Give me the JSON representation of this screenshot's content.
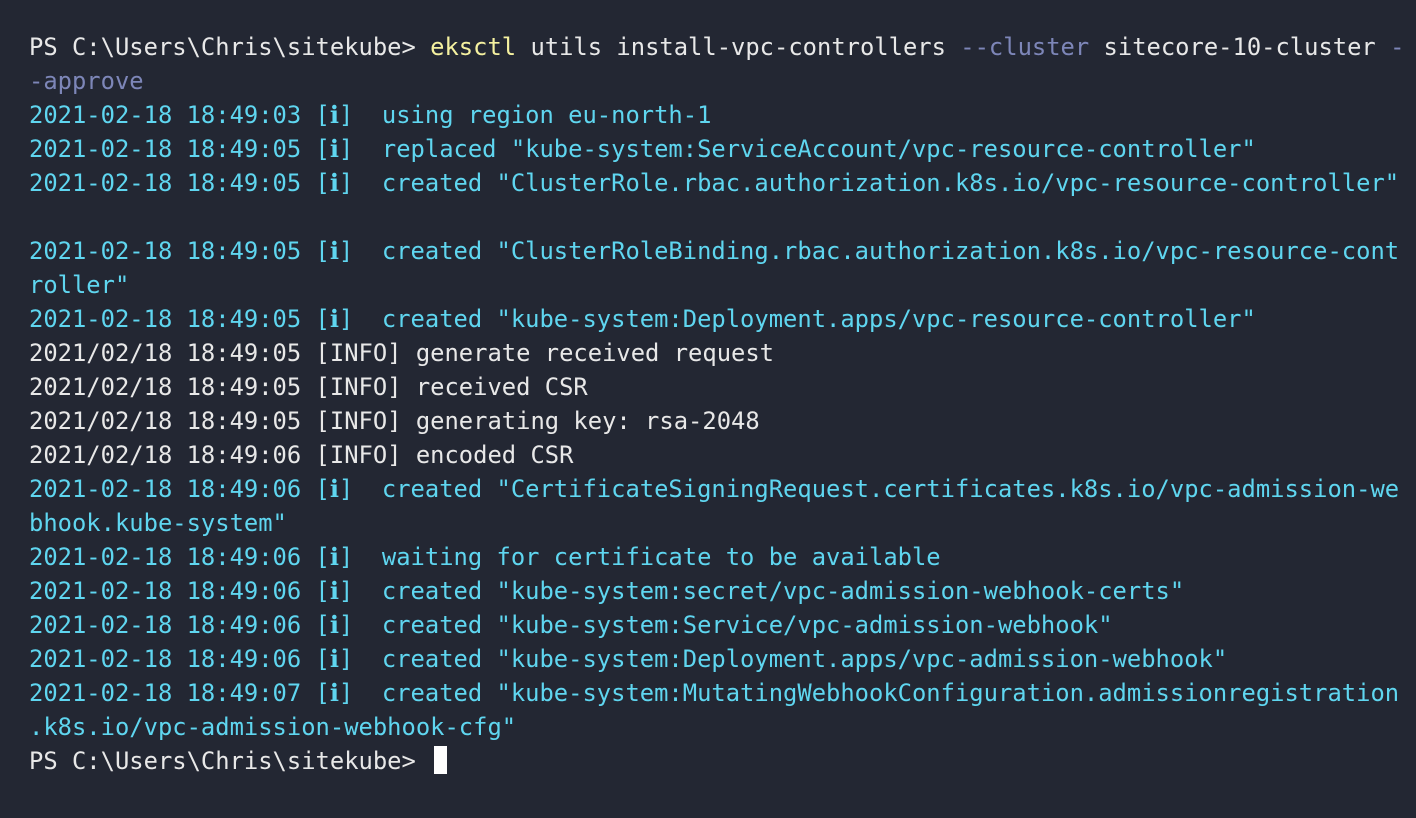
{
  "colors": {
    "background": "#232733",
    "command": "#f5f1a0",
    "flag": "#7d86b8",
    "info": "#5fd6f0",
    "plain": "#e8e8e8"
  },
  "terminal": {
    "prompt": "PS C:\\Users\\Chris\\sitekube> ",
    "command": {
      "executable": "eksctl",
      "args1": " utils install-vpc-controllers ",
      "flag_cluster": "--cluster",
      "cluster_name": " sitecore-10-cluster ",
      "flag_approve_part1": "-",
      "flag_approve_part2": "-approve"
    },
    "output_lines": [
      {
        "style": "info",
        "text": "2021-02-18 18:49:03 [ℹ]  using region eu-north-1"
      },
      {
        "style": "info",
        "text": "2021-02-18 18:49:05 [ℹ]  replaced \"kube-system:ServiceAccount/vpc-resource-controller\""
      },
      {
        "style": "info",
        "text": "2021-02-18 18:49:05 [ℹ]  created \"ClusterRole.rbac.authorization.k8s.io/vpc-resource-controller\""
      },
      {
        "style": "info",
        "text": ""
      },
      {
        "style": "info",
        "text": "2021-02-18 18:49:05 [ℹ]  created \"ClusterRoleBinding.rbac.authorization.k8s.io/vpc-resource-cont"
      },
      {
        "style": "info",
        "text": "roller\""
      },
      {
        "style": "info",
        "text": "2021-02-18 18:49:05 [ℹ]  created \"kube-system:Deployment.apps/vpc-resource-controller\""
      },
      {
        "style": "plain",
        "text": "2021/02/18 18:49:05 [INFO] generate received request"
      },
      {
        "style": "plain",
        "text": "2021/02/18 18:49:05 [INFO] received CSR"
      },
      {
        "style": "plain",
        "text": "2021/02/18 18:49:05 [INFO] generating key: rsa-2048"
      },
      {
        "style": "plain",
        "text": "2021/02/18 18:49:06 [INFO] encoded CSR"
      },
      {
        "style": "info",
        "text": "2021-02-18 18:49:06 [ℹ]  created \"CertificateSigningRequest.certificates.k8s.io/vpc-admission-we"
      },
      {
        "style": "info",
        "text": "bhook.kube-system\""
      },
      {
        "style": "info",
        "text": "2021-02-18 18:49:06 [ℹ]  waiting for certificate to be available"
      },
      {
        "style": "info",
        "text": "2021-02-18 18:49:06 [ℹ]  created \"kube-system:secret/vpc-admission-webhook-certs\""
      },
      {
        "style": "info",
        "text": "2021-02-18 18:49:06 [ℹ]  created \"kube-system:Service/vpc-admission-webhook\""
      },
      {
        "style": "info",
        "text": "2021-02-18 18:49:06 [ℹ]  created \"kube-system:Deployment.apps/vpc-admission-webhook\""
      },
      {
        "style": "info",
        "text": "2021-02-18 18:49:07 [ℹ]  created \"kube-system:MutatingWebhookConfiguration.admissionregistration"
      },
      {
        "style": "info",
        "text": ".k8s.io/vpc-admission-webhook-cfg\""
      }
    ],
    "final_prompt": "PS C:\\Users\\Chris\\sitekube> "
  }
}
